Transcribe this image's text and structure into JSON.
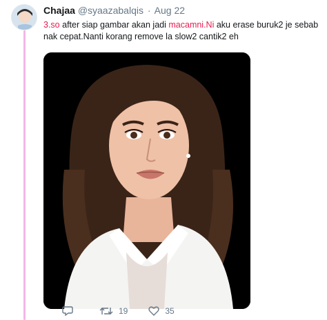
{
  "tweet": {
    "author_name": "Chajaa",
    "handle": "@syaazabalqis",
    "separator": "·",
    "time": "Aug 22",
    "text_mention1": "3.so",
    "text_part1": " after siap gambar akan jadi ",
    "text_mention2": "macamni.Ni",
    "text_part2": " aku erase buruk2 je sebab nak cepat.Nanti korang remove la slow2 cantik2 eh",
    "link_color": "#e81c4f",
    "thread_line_color": "#f2b6e6",
    "media": {
      "description_icon": "photo"
    }
  },
  "actions": {
    "reply": {
      "icon": "reply-icon",
      "count": ""
    },
    "retweet": {
      "icon": "retweet-icon",
      "count": "19"
    },
    "like": {
      "icon": "heart-icon",
      "count": "35"
    }
  }
}
